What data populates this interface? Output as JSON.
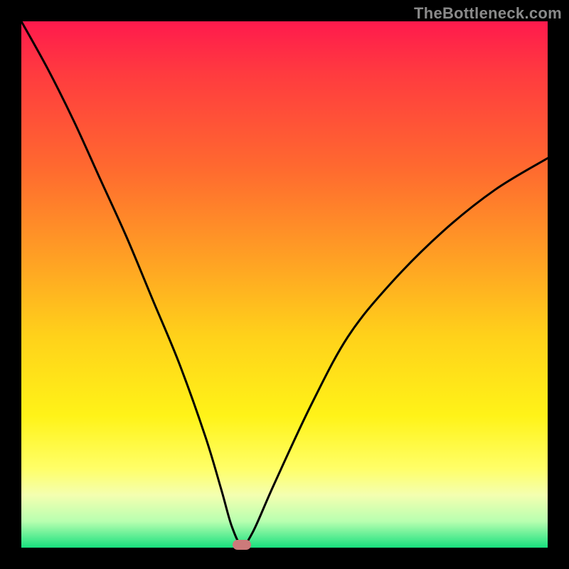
{
  "watermark": "TheBottleneck.com",
  "chart_data": {
    "type": "line",
    "title": "",
    "xlabel": "",
    "ylabel": "",
    "xlim": [
      0,
      100
    ],
    "ylim": [
      0,
      100
    ],
    "grid": false,
    "legend": false,
    "background": "red-yellow-green vertical gradient",
    "series": [
      {
        "name": "bottleneck-curve",
        "x": [
          0,
          5,
          10,
          15,
          20,
          25,
          30,
          35,
          38,
          40,
          41.9,
          44,
          48,
          55,
          62,
          70,
          80,
          90,
          100
        ],
        "y": [
          100,
          91,
          81,
          70,
          59,
          47,
          35,
          21,
          11,
          4,
          0.5,
          3,
          12,
          27,
          40,
          50,
          60,
          68,
          74
        ]
      }
    ],
    "annotations": [
      {
        "name": "min-marker",
        "x": 41.9,
        "y": 0.5,
        "shape": "pill",
        "color": "#cc7a7a"
      }
    ],
    "colors": {
      "curve": "#000000",
      "gradient_top": "#ff1a4d",
      "gradient_mid": "#ffd21a",
      "gradient_bottom": "#18e07e",
      "marker": "#cc7a7a",
      "frame": "#000000"
    }
  },
  "layout": {
    "image_size": 800,
    "plot_origin_x": 30,
    "plot_origin_y": 30,
    "plot_size": 740
  }
}
